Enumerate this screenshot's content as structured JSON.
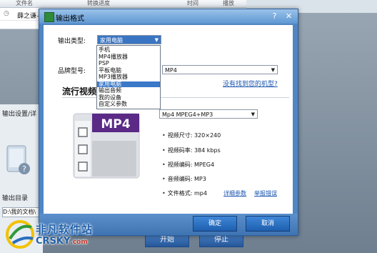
{
  "background": {
    "table_headers": [
      "文件名",
      "转换进度",
      "时间",
      "播放"
    ],
    "row_name": "薛之谦-",
    "section_output_settings": "输出设置/详",
    "section_output_dir": "输出目录",
    "output_path": "D:\\我的文档\\",
    "start_label": "开始",
    "stop_label": "停止"
  },
  "watermark": {
    "text": "非凡软件站",
    "domain": "CRSKY",
    "tld": ".com"
  },
  "dialog": {
    "title": "输出格式",
    "help": "?",
    "close": "✕",
    "output_type_label": "输出类型:",
    "output_type_value": "家用电脑",
    "output_type_options": [
      "手机",
      "MP4播放器",
      "PSP",
      "平板电脑",
      "MP3播放器",
      "家用电脑",
      "输出音频",
      "我的设备",
      "自定义参数"
    ],
    "selected_index": 5,
    "brand_label": "品牌型号:",
    "model_value": "MP4",
    "no_model_link": "没有找到您的机型?",
    "section_title": "流行视频",
    "format_value": "Mp4 MPEG4+MP3",
    "film_label": "MP4",
    "specs": [
      {
        "label": "视频尺寸:",
        "value": "320×240"
      },
      {
        "label": "视频码率:",
        "value": "384 kbps"
      },
      {
        "label": "视频编码:",
        "value": "MPEG4"
      },
      {
        "label": "音频编码:",
        "value": "MP3"
      },
      {
        "label": "文件格式:",
        "value": "mp4"
      }
    ],
    "detail_link": "详细参数",
    "report_link": "举报错误",
    "ok_label": "确定",
    "cancel_label": "取消"
  }
}
